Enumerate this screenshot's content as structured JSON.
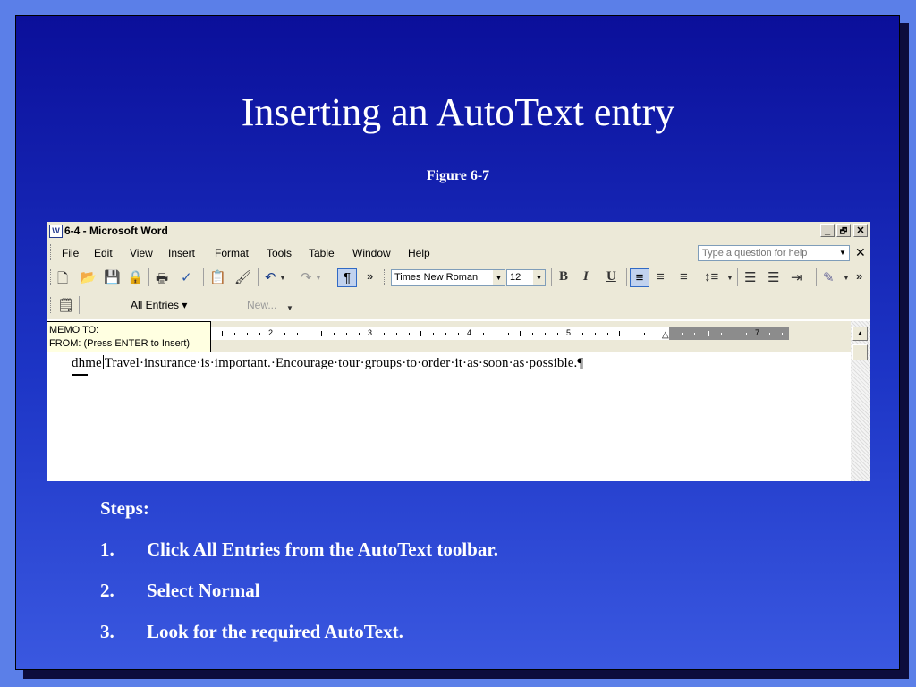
{
  "slide": {
    "title": "Inserting an AutoText entry",
    "subtitle": "Figure 6-7"
  },
  "window": {
    "title": "6-4 - Microsoft Word",
    "app_icon": "W",
    "controls": {
      "minimize": "_",
      "restore": "🗗",
      "close": "✕"
    }
  },
  "menubar": {
    "items": [
      "File",
      "Edit",
      "View",
      "Insert",
      "Format",
      "Tools",
      "Table",
      "Window",
      "Help"
    ],
    "help_placeholder": "Type a question for help",
    "close_doc": "✕"
  },
  "formatting": {
    "font": "Times New Roman",
    "size": "12",
    "bold": "B",
    "italic": "I",
    "underline": "U",
    "show_marks": "¶",
    "more": "»"
  },
  "autotext_toolbar": {
    "all_entries": "All Entries ▾",
    "new_button": "New..."
  },
  "memo_tooltip": {
    "line1": "MEMO TO:",
    "line2": "FROM:   (Press ENTER to Insert)"
  },
  "ruler": {
    "labels": [
      "2",
      "3",
      "4",
      "5",
      "7"
    ]
  },
  "document": {
    "typed": "dhme",
    "text": "Travel·insurance·is·important.·Encourage·tour·groups·to·order·it·as·soon·as·possible.¶"
  },
  "steps": {
    "heading": "Steps:",
    "items": [
      {
        "num": "1.",
        "text": "Click All Entries from the AutoText toolbar."
      },
      {
        "num": "2.",
        "text": "Select Normal"
      },
      {
        "num": "3.",
        "text": "Look for the required AutoText."
      }
    ]
  },
  "colors": {
    "slide_bg_top": "#0b0f9a",
    "slide_bg_bottom": "#3a58e0",
    "outer_bg": "#5b7fe8",
    "tooltip_bg": "#ffffe1"
  }
}
